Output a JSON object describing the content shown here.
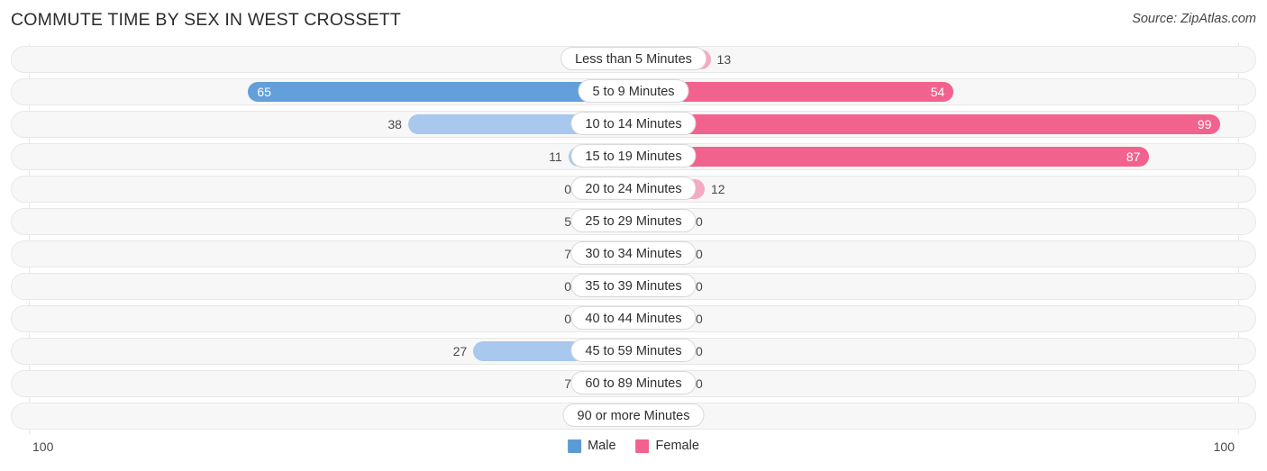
{
  "header": {
    "title": "COMMUTE TIME BY SEX IN WEST CROSSETT",
    "source": "Source: ZipAtlas.com"
  },
  "axis": {
    "left_end": "100",
    "right_end": "100"
  },
  "legend": [
    {
      "label": "Male",
      "color": "#5b9bd5"
    },
    {
      "label": "Female",
      "color": "#f2628f"
    }
  ],
  "colors": {
    "male_strong": "#629fdb",
    "male_light": "#a8c8ee",
    "female_strong": "#f2628f",
    "female_light": "#f7a8c4",
    "track": "#f7f7f7",
    "track_border": "#e8e8e8",
    "gridline": "#e6e6e6"
  },
  "chart_data": {
    "type": "bar",
    "title": "COMMUTE TIME BY SEX IN WEST CROSSETT",
    "subtitle": "Source: ZipAtlas.com",
    "orientation": "horizontal-diverging",
    "xlabel": "",
    "ylabel": "",
    "xlim": [
      0,
      100
    ],
    "grid": true,
    "legend_position": "bottom-center",
    "categories": [
      "Less than 5 Minutes",
      "5 to 9 Minutes",
      "10 to 14 Minutes",
      "15 to 19 Minutes",
      "20 to 24 Minutes",
      "25 to 29 Minutes",
      "30 to 34 Minutes",
      "35 to 39 Minutes",
      "40 to 44 Minutes",
      "45 to 59 Minutes",
      "60 to 89 Minutes",
      "90 or more Minutes"
    ],
    "series": [
      {
        "name": "Male",
        "values": [
          0,
          65,
          38,
          11,
          0,
          5,
          7,
          0,
          0,
          27,
          7,
          0
        ]
      },
      {
        "name": "Female",
        "values": [
          13,
          54,
          99,
          87,
          12,
          0,
          0,
          0,
          0,
          0,
          0,
          0
        ]
      }
    ]
  },
  "rows": [
    {
      "category": "Less than 5 Minutes",
      "male": "0",
      "female": "13"
    },
    {
      "category": "5 to 9 Minutes",
      "male": "65",
      "female": "54"
    },
    {
      "category": "10 to 14 Minutes",
      "male": "38",
      "female": "99"
    },
    {
      "category": "15 to 19 Minutes",
      "male": "11",
      "female": "87"
    },
    {
      "category": "20 to 24 Minutes",
      "male": "0",
      "female": "12"
    },
    {
      "category": "25 to 29 Minutes",
      "male": "5",
      "female": "0"
    },
    {
      "category": "30 to 34 Minutes",
      "male": "7",
      "female": "0"
    },
    {
      "category": "35 to 39 Minutes",
      "male": "0",
      "female": "0"
    },
    {
      "category": "40 to 44 Minutes",
      "male": "0",
      "female": "0"
    },
    {
      "category": "45 to 59 Minutes",
      "male": "27",
      "female": "0"
    },
    {
      "category": "60 to 89 Minutes",
      "male": "7",
      "female": "0"
    },
    {
      "category": "90 or more Minutes",
      "male": "0",
      "female": "0"
    }
  ]
}
